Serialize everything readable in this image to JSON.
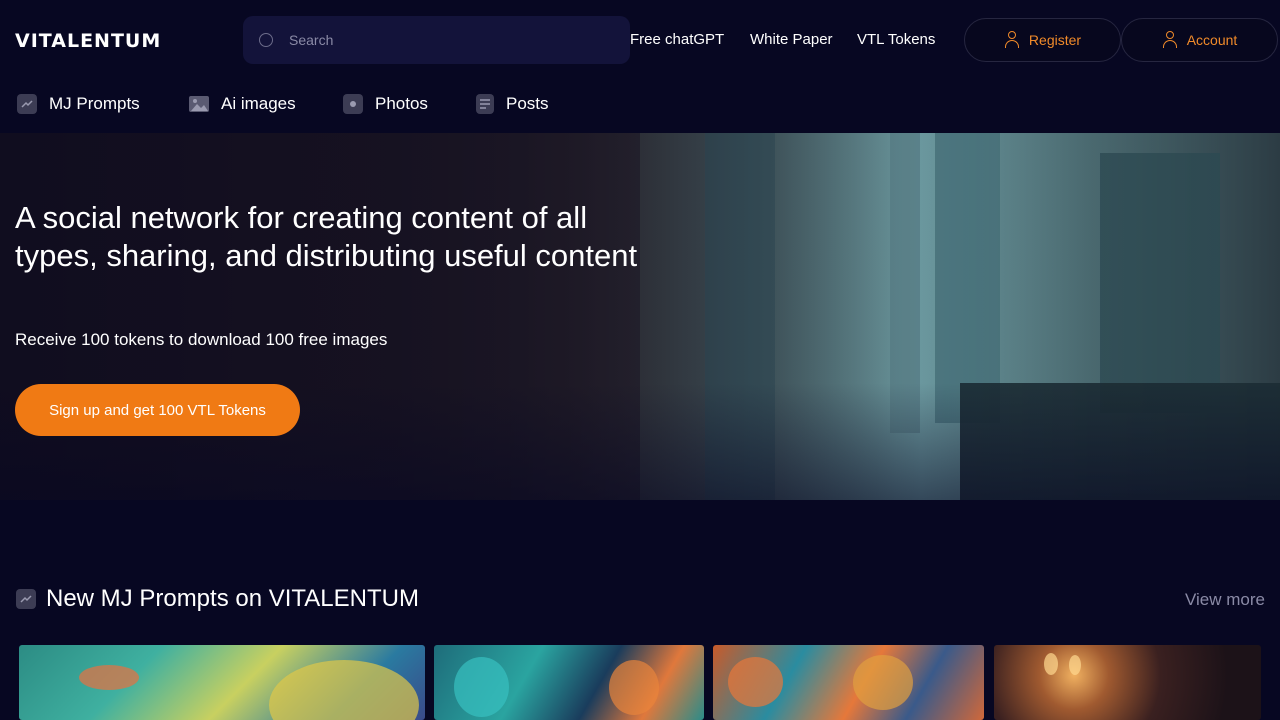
{
  "header": {
    "logo": "VITALENTUM",
    "search_placeholder": "Search",
    "nav_links": [
      "Free chatGPT",
      "White Paper",
      "VTL Tokens"
    ],
    "register_label": "Register",
    "account_label": "Account"
  },
  "categories": [
    {
      "label": "MJ Prompts",
      "icon": "trend-icon"
    },
    {
      "label": "Ai images",
      "icon": "image-icon"
    },
    {
      "label": "Photos",
      "icon": "camera-icon"
    },
    {
      "label": "Posts",
      "icon": "document-icon"
    }
  ],
  "hero": {
    "title": "A social network for creating content of all types, sharing, and distributing useful content",
    "subtitle": "Receive 100 tokens to download 100 free images",
    "cta_label": "Sign up and get 100 VTL Tokens"
  },
  "section": {
    "title": "New MJ Prompts on VITALENTUM",
    "view_more": "View more"
  },
  "colors": {
    "background": "#070722",
    "accent": "#f07a14",
    "muted_text": "#8a8aa6"
  }
}
